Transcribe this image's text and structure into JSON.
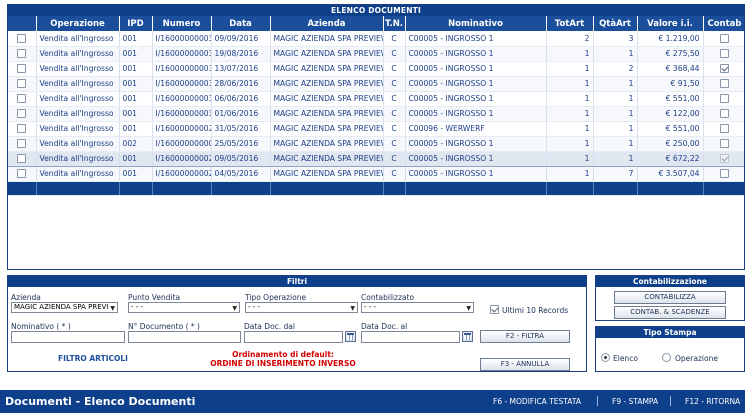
{
  "grid": {
    "title": "ELENCO DOCUMENTI",
    "columns": [
      "",
      "Operazione",
      "IPD",
      "Numero",
      "Data",
      "Azienda",
      "T.N.",
      "Nominativo",
      "TotArt",
      "QtàArt",
      "Valore i.i.",
      "Contab"
    ],
    "rows": [
      {
        "sel": false,
        "operazione": "Vendita all'Ingrosso",
        "ipd": "001",
        "numero": "I/160000000035",
        "data": "09/09/2016",
        "azienda": "MAGIC AZIENDA SPA PREVIEW",
        "tn": "C",
        "nominativo": "C00005 - INGROSSO 1",
        "totart": "2",
        "qtaart": "3",
        "valore": "€ 1.219,00",
        "contab": false,
        "contab_disabled": false
      },
      {
        "sel": false,
        "operazione": "Vendita all'Ingrosso",
        "ipd": "001",
        "numero": "I/160000000034",
        "data": "19/08/2016",
        "azienda": "MAGIC AZIENDA SPA PREVIEW",
        "tn": "C",
        "nominativo": "C00005 - INGROSSO 1",
        "totart": "1",
        "qtaart": "1",
        "valore": "€ 275,50",
        "contab": false,
        "contab_disabled": false
      },
      {
        "sel": false,
        "operazione": "Vendita all'Ingrosso",
        "ipd": "001",
        "numero": "I/160000000033",
        "data": "13/07/2016",
        "azienda": "MAGIC AZIENDA SPA PREVIEW",
        "tn": "C",
        "nominativo": "C00005 - INGROSSO 1",
        "totart": "1",
        "qtaart": "2",
        "valore": "€ 368,44",
        "contab": true,
        "contab_disabled": false
      },
      {
        "sel": false,
        "operazione": "Vendita all'Ingrosso",
        "ipd": "001",
        "numero": "I/160000000032",
        "data": "28/06/2016",
        "azienda": "MAGIC AZIENDA SPA PREVIEW",
        "tn": "C",
        "nominativo": "C00005 - INGROSSO 1",
        "totart": "1",
        "qtaart": "1",
        "valore": "€ 91,50",
        "contab": false,
        "contab_disabled": false
      },
      {
        "sel": false,
        "operazione": "Vendita all'Ingrosso",
        "ipd": "001",
        "numero": "I/160000000031",
        "data": "06/06/2016",
        "azienda": "MAGIC AZIENDA SPA PREVIEW",
        "tn": "C",
        "nominativo": "C00005 - INGROSSO 1",
        "totart": "1",
        "qtaart": "1",
        "valore": "€ 551,00",
        "contab": false,
        "contab_disabled": false
      },
      {
        "sel": false,
        "operazione": "Vendita all'Ingrosso",
        "ipd": "001",
        "numero": "I/160000000030",
        "data": "01/06/2016",
        "azienda": "MAGIC AZIENDA SPA PREVIEW",
        "tn": "C",
        "nominativo": "C00005 - INGROSSO 1",
        "totart": "1",
        "qtaart": "1",
        "valore": "€ 122,00",
        "contab": false,
        "contab_disabled": false
      },
      {
        "sel": false,
        "operazione": "Vendita all'Ingrosso",
        "ipd": "001",
        "numero": "I/160000000029",
        "data": "31/05/2016",
        "azienda": "MAGIC AZIENDA SPA PREVIEW",
        "tn": "C",
        "nominativo": "C00096 - WERWERF",
        "totart": "1",
        "qtaart": "1",
        "valore": "€ 551,00",
        "contab": false,
        "contab_disabled": false
      },
      {
        "sel": false,
        "operazione": "Vendita all'Ingrosso",
        "ipd": "002",
        "numero": "I/160000000001",
        "data": "25/05/2016",
        "azienda": "MAGIC AZIENDA SPA PREVIEW",
        "tn": "C",
        "nominativo": "C00005 - INGROSSO 1",
        "totart": "1",
        "qtaart": "1",
        "valore": "€ 250,00",
        "contab": false,
        "contab_disabled": false
      },
      {
        "sel": false,
        "operazione": "Vendita all'Ingrosso",
        "ipd": "001",
        "numero": "I/160000000028",
        "data": "09/05/2016",
        "azienda": "MAGIC AZIENDA SPA PREVIEW",
        "tn": "C",
        "nominativo": "C00005 - INGROSSO 1",
        "totart": "1",
        "qtaart": "1",
        "valore": "€ 672,22",
        "contab": true,
        "contab_disabled": true,
        "selected": true
      },
      {
        "sel": false,
        "operazione": "Vendita all'Ingrosso",
        "ipd": "001",
        "numero": "I/160000000027",
        "data": "04/05/2016",
        "azienda": "MAGIC AZIENDA SPA PREVIEW",
        "tn": "C",
        "nominativo": "C00005 - INGROSSO 1",
        "totart": "1",
        "qtaart": "7",
        "valore": "€ 3.507,04",
        "contab": false,
        "contab_disabled": false
      }
    ]
  },
  "filters": {
    "title": "Filtri",
    "azienda_label": "Azienda",
    "azienda_value": "MAGIC AZIENDA SPA PREVI",
    "punto_vendita_label": "Punto Vendita",
    "punto_vendita_value": "- - -",
    "tipo_operazione_label": "Tipo Operazione",
    "tipo_operazione_value": "- - -",
    "contabilizzato_label": "Contabilizzato",
    "contabilizzato_value": "- - -",
    "ultimi_label": "Ultimi 10 Records",
    "ultimi_checked": true,
    "nominativo_label": "Nominativo ( * )",
    "ndoc_label": "N° Documento ( * )",
    "data_dal_label": "Data Doc. dal",
    "data_al_label": "Data Doc. al",
    "filtra_button": "F2 - FILTRA",
    "annulla_button": "F3 - ANNULLA",
    "filtro_articoli": "FILTRO ARTICOLI",
    "ordinamento_line1": "Ordinamento di default:",
    "ordinamento_line2": "ORDINE DI INSERIMENTO INVERSO"
  },
  "contabilizzazione": {
    "title": "Contabilizzazione",
    "contabilizza_button": "CONTABILIZZA",
    "scadenze_button": "CONTAB. & SCADENZE"
  },
  "tipo_stampa": {
    "title": "Tipo Stampa",
    "option_elenco": "Elenco",
    "option_operazione": "Operazione",
    "selected": "Elenco"
  },
  "statusbar": {
    "title": "Documenti - Elenco Documenti",
    "f6": "F6 - MODIFICA TESTATA",
    "f9": "F9 - STAMPA",
    "f12": "F12 - RITORNA"
  },
  "colors": {
    "header_bg": "#0d3f8a",
    "column_header_bg": "#1b4f9c",
    "row_text": "#1d3f86",
    "warning_text": "#d40000"
  }
}
